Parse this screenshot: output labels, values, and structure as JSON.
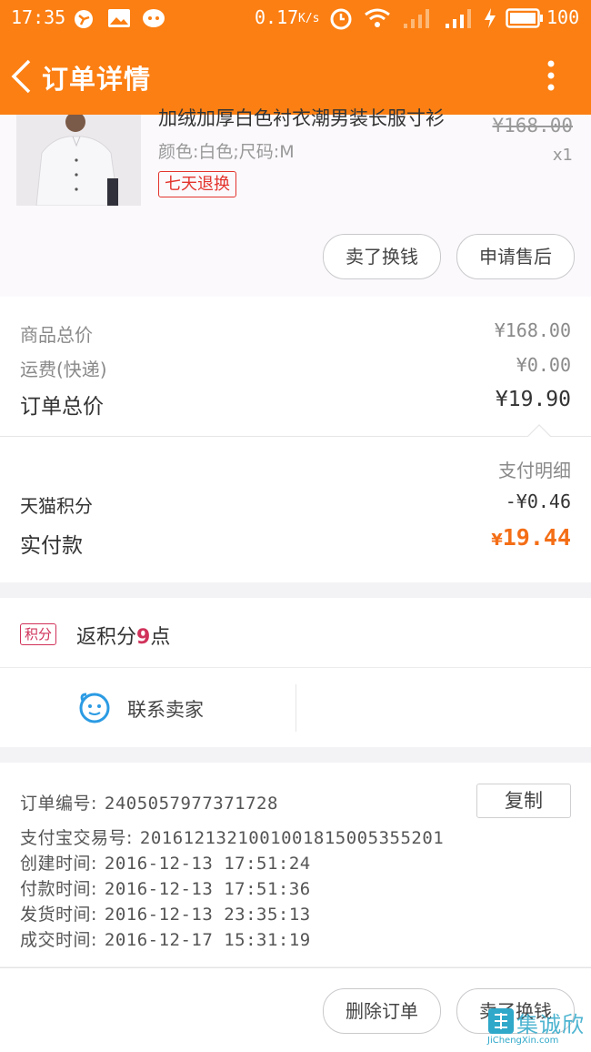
{
  "status_bar": {
    "time": "17:35",
    "net_speed": "0.17",
    "net_unit": "K/s",
    "battery": "100"
  },
  "title_bar": {
    "title": "订单详情"
  },
  "product": {
    "name_partial": "加绒加厚白色衬衣潮男装长服寸衫",
    "price": "¥168.00",
    "quantity": "x1",
    "spec": "颜色:白色;尺码:M",
    "return_tag": "七天退换",
    "sell_button": "卖了换钱",
    "aftersale_button": "申请售后"
  },
  "summary": {
    "goods_total_label": "商品总价",
    "goods_total_value": "¥168.00",
    "shipping_label": "运费(快递)",
    "shipping_value": "¥0.00",
    "order_total_label": "订单总价",
    "order_total_value": "¥19.90",
    "payment_detail_label": "支付明细",
    "points_label": "天猫积分",
    "points_value": "-¥0.46",
    "paid_label": "实付款",
    "paid_currency": "¥",
    "paid_value": "19.44"
  },
  "points": {
    "badge": "积分",
    "text_prefix": "返积分",
    "amount": "9",
    "text_suffix": "点",
    "contact_label": "联系卖家"
  },
  "order_info": {
    "order_no_label": "订单编号:",
    "order_no": "2405057977371728",
    "copy_button": "复制",
    "alipay_label": "支付宝交易号:",
    "alipay_no": "2016121321001001815005355201",
    "created_label": "创建时间:",
    "created": "2016-12-13 17:51:24",
    "paid_label": "付款时间:",
    "paid": "2016-12-13 17:51:36",
    "shipped_label": "发货时间:",
    "shipped": "2016-12-13 23:35:13",
    "done_label": "成交时间:",
    "done": "2016-12-17 15:31:19"
  },
  "bottom_bar": {
    "delete_button": "删除订单",
    "sell_button": "卖了换钱"
  },
  "watermark": {
    "text": "集诚欣",
    "url": "JiChengXin.com"
  },
  "colors": {
    "brand_orange": "#fb7f13",
    "price_orange": "#f46e16",
    "tag_red": "#e3342d"
  }
}
